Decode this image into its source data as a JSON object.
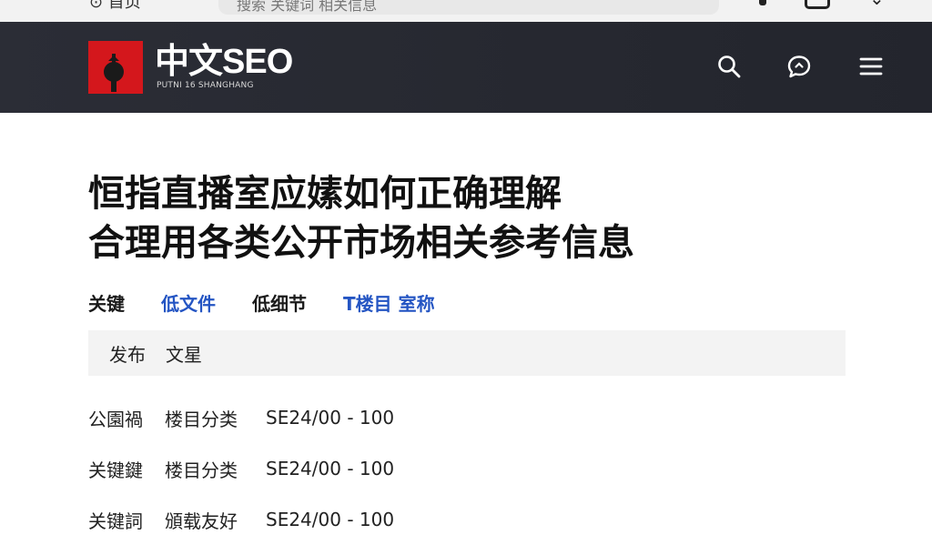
{
  "browser": {
    "left_text": "⊙ 首页",
    "url_text": "搜索 关键词 相关信息"
  },
  "header": {
    "logo_title": "中文SEO",
    "logo_subtitle": "PUTNI 16 SHANGHANG",
    "colors": {
      "background": "#2b2d36",
      "logo_red": "#d4171c"
    },
    "icons": [
      "search-icon",
      "chat-icon",
      "menu-icon"
    ]
  },
  "article": {
    "title_line1": "恒指直播室应嫊如何正确理解",
    "title_line2": "合理用各类公开市场相关参考信息",
    "tags": [
      {
        "label": "关键",
        "style": "dark"
      },
      {
        "label": "低文件",
        "style": "link"
      },
      {
        "label": "低细节",
        "style": "dark"
      },
      {
        "label": "T楼目 室称",
        "style": "link"
      }
    ],
    "meta": [
      "发布",
      "文星"
    ],
    "rows": [
      {
        "col1": "公園禍",
        "col2": "楼目分类",
        "col3": "SE24/00 - 100"
      },
      {
        "col1": "关键鍵",
        "col2": "楼目分类",
        "col3": "SE24/00 - 100"
      },
      {
        "col1": "关键詞",
        "col2": "頒载友好",
        "col3": "SE24/00 - 100"
      }
    ]
  },
  "colors": {
    "link": "#2455c3",
    "meta_bg": "#f3f3f3"
  }
}
